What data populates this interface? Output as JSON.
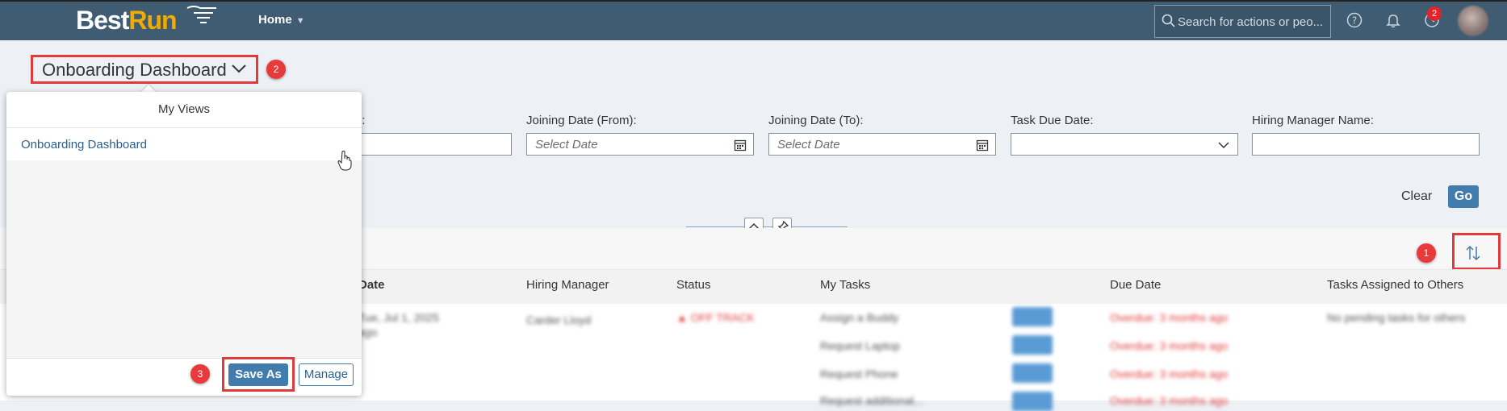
{
  "shell": {
    "logo_best": "Best",
    "logo_run": "Run",
    "home_label": "Home",
    "search_placeholder": "Search for actions or peo...",
    "notification_count": "2",
    "icons": [
      "search-icon",
      "help-icon",
      "bell-icon",
      "refresh-icon"
    ]
  },
  "header": {
    "title": "Onboarding Dashboard"
  },
  "callouts": {
    "sort": "1",
    "title": "2",
    "save_as": "3"
  },
  "filters": {
    "partial_label": "e:",
    "joining_from": {
      "label": "Joining Date (From):",
      "placeholder": "Select Date"
    },
    "joining_to": {
      "label": "Joining Date (To):",
      "placeholder": "Select Date"
    },
    "task_due": {
      "label": "Task Due Date:"
    },
    "hiring_manager": {
      "label": "Hiring Manager Name:"
    },
    "clear_label": "Clear",
    "go_label": "Go"
  },
  "table": {
    "columns": [
      "Date",
      "Hiring Manager",
      "Status",
      "My Tasks",
      "Due Date",
      "Tasks Assigned to Others"
    ],
    "blurred_row": {
      "date": "Tue, Jul 1, 2025",
      "date_sub": "ago",
      "manager": "Carder Lloyd",
      "status": "OFF TRACK",
      "tasks": [
        "Assign a Buddy",
        "Request Laptop",
        "Request Phone",
        "Request additional..."
      ],
      "due": [
        "Overdue: 3 months ago",
        "Overdue: 3 months ago",
        "Overdue: 3 months ago",
        "Overdue: 3 months ago"
      ],
      "others": "No pending tasks for others"
    }
  },
  "popover": {
    "header": "My Views",
    "items": [
      "Onboarding Dashboard"
    ],
    "save_as_label": "Save As",
    "manage_label": "Manage"
  },
  "colors": {
    "shell": "#3f5c73",
    "accent": "#427cac",
    "callout": "#e03a3a",
    "logo_run": "#f0ab00"
  }
}
